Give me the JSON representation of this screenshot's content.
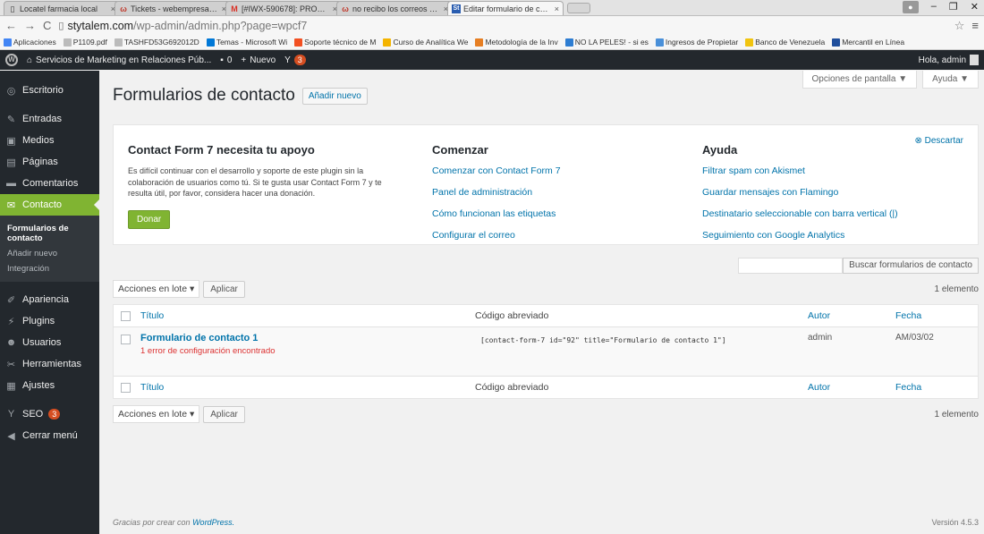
{
  "browser": {
    "tabs": [
      {
        "label": "Locatel farmacia local",
        "favicon": "page-icon"
      },
      {
        "label": "Tickets - webempresa.com",
        "favicon": "w-icon"
      },
      {
        "label": "[#IWX-590678]: PROBLEM",
        "favicon": "gmail-icon"
      },
      {
        "label": "no recibo los correos a tra",
        "favicon": "w-icon"
      },
      {
        "label": "Editar formulario de conta",
        "favicon": "st-icon"
      }
    ],
    "url_host": "stytalem.com",
    "url_path": "/wp-admin/admin.php?page=wpcf7",
    "bookmarks": [
      {
        "label": "Aplicaciones",
        "color": "#4285f4"
      },
      {
        "label": "P1109.pdf",
        "color": "#bbbbbb"
      },
      {
        "label": "TASHFD53G692012D",
        "color": "#bbbbbb"
      },
      {
        "label": "Temas - Microsoft Wi",
        "color": "#0078d7"
      },
      {
        "label": "Soporte técnico de M",
        "color": "#f25022"
      },
      {
        "label": "Curso de Analítica We",
        "color": "#f4b400"
      },
      {
        "label": "Metodología de la Inv",
        "color": "#e67e22"
      },
      {
        "label": "NO LA PELES! - si es",
        "color": "#2d7dd2"
      },
      {
        "label": "Ingresos de Propietar",
        "color": "#4a90d9"
      },
      {
        "label": "Banco de Venezuela",
        "color": "#f1c40f"
      },
      {
        "label": "Mercantil en Línea",
        "color": "#1f4e9c"
      }
    ]
  },
  "adminbar": {
    "site_name": "Servicios de Marketing en Relaciones Púb...",
    "comments_count": "0",
    "new_label": "Nuevo",
    "seo_badge": "3",
    "greeting": "Hola, admin"
  },
  "sidebar": {
    "items": [
      {
        "label": "Escritorio",
        "icon": "dashboard-icon"
      },
      {
        "label": "Entradas",
        "icon": "pin-icon"
      },
      {
        "label": "Medios",
        "icon": "media-icon"
      },
      {
        "label": "Páginas",
        "icon": "pages-icon"
      },
      {
        "label": "Comentarios",
        "icon": "comments-icon"
      },
      {
        "label": "Contacto",
        "icon": "mail-icon"
      }
    ],
    "submenu": [
      "Formularios de contacto",
      "Añadir nuevo",
      "Integración"
    ],
    "items2": [
      {
        "label": "Apariencia",
        "icon": "brush-icon"
      },
      {
        "label": "Plugins",
        "icon": "plugin-icon"
      },
      {
        "label": "Usuarios",
        "icon": "users-icon"
      },
      {
        "label": "Herramientas",
        "icon": "wrench-icon"
      },
      {
        "label": "Ajustes",
        "icon": "settings-icon"
      }
    ],
    "seo_label": "SEO",
    "seo_badge": "3",
    "collapse_label": "Cerrar menú"
  },
  "screen_options": {
    "options": "Opciones de pantalla ▼",
    "help": "Ayuda ▼"
  },
  "page": {
    "title": "Formularios de contacto",
    "add_new": "Añadir nuevo"
  },
  "welcome": {
    "dismiss": "Descartar",
    "col1_title": "Contact Form 7 necesita tu apoyo",
    "col1_text": "Es difícil continuar con el desarrollo y soporte de este plugin sin la colaboración de usuarios como tú. Si te gusta usar Contact Form 7 y te resulta útil, por favor, considera hacer una donación.",
    "donate": "Donar",
    "col2_title": "Comenzar",
    "col2_links": [
      "Comenzar con Contact Form 7",
      "Panel de administración",
      "Cómo funcionan las etiquetas",
      "Configurar el correo"
    ],
    "col3_title": "Ayuda",
    "col3_links": [
      "Filtrar spam con Akismet",
      "Guardar mensajes con Flamingo",
      "Destinatario seleccionable con barra vertical (|)",
      "Seguimiento con Google Analytics"
    ]
  },
  "search": {
    "button": "Buscar formularios de contacto",
    "value": ""
  },
  "bulk": {
    "select": "Acciones en lote",
    "apply": "Aplicar",
    "count": "1 elemento"
  },
  "table": {
    "columns": [
      "Título",
      "Código abreviado",
      "Autor",
      "Fecha"
    ],
    "rows": [
      {
        "title": "Formulario de contacto 1",
        "error": "1 error de configuración encontrado",
        "shortcode": "[contact-form-7 id=\"92\" title=\"Formulario de contacto 1\"]",
        "author": "admin",
        "date": "AM/03/02"
      }
    ]
  },
  "footer": {
    "thanks": "Gracias por crear con",
    "wp": "WordPress.",
    "version": "Versión 4.5.3"
  }
}
